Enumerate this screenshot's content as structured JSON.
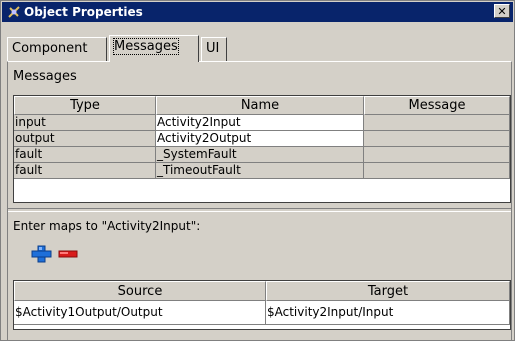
{
  "window": {
    "title": "Object Properties",
    "close_glyph": "✕"
  },
  "tabs": [
    {
      "label": "Component"
    },
    {
      "label": "Messages"
    },
    {
      "label": "UI"
    }
  ],
  "messages": {
    "section_label": "Messages",
    "columns": [
      "Type",
      "Name",
      "Message"
    ],
    "rows": [
      {
        "type": "input",
        "name": "Activity2Input",
        "message": ""
      },
      {
        "type": "output",
        "name": "Activity2Output",
        "message": ""
      },
      {
        "type": "fault",
        "name": "_SystemFault",
        "message": ""
      },
      {
        "type": "fault",
        "name": "_TimeoutFault",
        "message": ""
      }
    ]
  },
  "maps": {
    "label": "Enter maps to \"Activity2Input\":",
    "add_icon": "plus-icon",
    "remove_icon": "minus-icon",
    "add_color": "#1e6fd9",
    "remove_color": "#d81c1c",
    "columns": [
      "Source",
      "Target"
    ],
    "rows": [
      {
        "source": "$Activity1Output/Output",
        "target": "$Activity2Input/Input"
      }
    ]
  }
}
